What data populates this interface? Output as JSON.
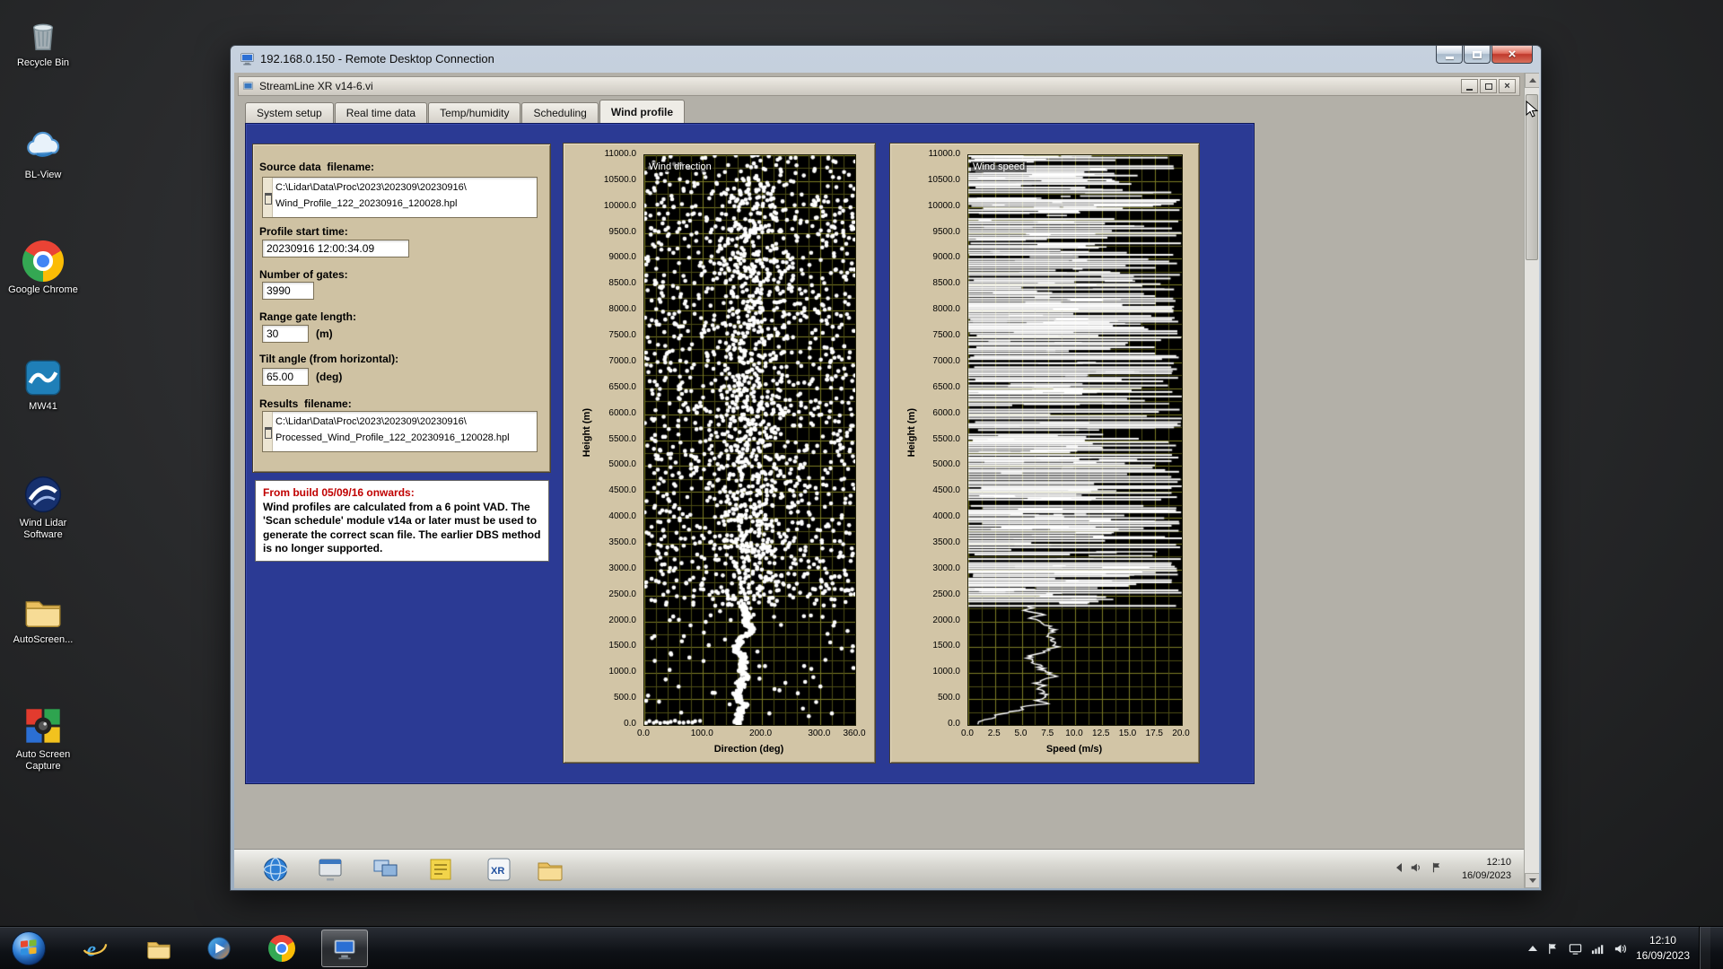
{
  "desktop": {
    "icons": [
      {
        "name": "recycle-bin",
        "label": "Recycle Bin"
      },
      {
        "name": "bl-view",
        "label": "BL-View"
      },
      {
        "name": "google-chrome",
        "label": "Google Chrome"
      },
      {
        "name": "mw41",
        "label": "MW41"
      },
      {
        "name": "wind-lidar-software",
        "label": "Wind Lidar Software"
      },
      {
        "name": "autoscreen",
        "label": "AutoScreen..."
      },
      {
        "name": "auto-screen-capture",
        "label": "Auto Screen Capture"
      }
    ]
  },
  "rdp": {
    "title": "192.168.0.150 - Remote Desktop Connection"
  },
  "app": {
    "title": "StreamLine XR v14-6.vi",
    "tabs": [
      {
        "label": "System setup",
        "active": false
      },
      {
        "label": "Real time data",
        "active": false
      },
      {
        "label": "Temp/humidity",
        "active": false
      },
      {
        "label": "Scheduling",
        "active": false
      },
      {
        "label": "Wind profile",
        "active": true
      }
    ],
    "fields": {
      "source_label": "Source data  filename:",
      "source_line1": "C:\\Lidar\\Data\\Proc\\2023\\202309\\20230916\\",
      "source_line2": "Wind_Profile_122_20230916_120028.hpl",
      "start_label": "Profile start time:",
      "start_value": "20230916 12:00:34.09",
      "gates_label": "Number of gates:",
      "gates_value": "3990",
      "range_label": "Range gate length:",
      "range_value": "30",
      "range_unit": "(m)",
      "tilt_label": "Tilt angle (from horizontal):",
      "tilt_value": "65.00",
      "tilt_unit": "(deg)",
      "results_label": "Results  filename:",
      "results_line1": "C:\\Lidar\\Data\\Proc\\2023\\202309\\20230916\\",
      "results_line2": "Processed_Wind_Profile_122_20230916_120028.hpl"
    },
    "notice": {
      "heading": "From build 05/09/16 onwards:",
      "body": "Wind profiles are calculated from a 6 point VAD. The 'Scan schedule' module v14a or later must be used to generate the correct scan file. The earlier DBS method is no longer supported."
    }
  },
  "chart_data": [
    {
      "type": "scatter",
      "title": "Wind direction",
      "xlabel": "Direction (deg)",
      "ylabel": "Height (m)",
      "xlim": [
        0,
        360
      ],
      "ylim": [
        0,
        11000
      ],
      "xticks": [
        0,
        100,
        200,
        300,
        360
      ],
      "yticks": [
        0,
        500,
        1000,
        1500,
        2000,
        2500,
        3000,
        3500,
        4000,
        4500,
        5000,
        5500,
        6000,
        6500,
        7000,
        7500,
        8000,
        8500,
        9000,
        9500,
        10000,
        10500,
        11000
      ],
      "grid": true,
      "plot_bg": "#000000",
      "grid_minor": "#4c4c16",
      "grid_major": "#7d7d26",
      "point_color": "#ffffff",
      "pattern": {
        "seed": 20230916,
        "noise_points": 1500,
        "cluster_points": 650,
        "cluster_center_deg": 185,
        "cluster_sd_deg": 80,
        "noise_above_m": 2300,
        "outlier_points": 70,
        "profile_top_m": 2300,
        "profile_start_deg": 172
      }
    },
    {
      "type": "line",
      "title": "Wind speed",
      "xlabel": "Speed (m/s)",
      "ylabel": "Height (m)",
      "xlim": [
        0,
        20
      ],
      "ylim": [
        0,
        11000
      ],
      "xticks": [
        0,
        2.5,
        5,
        7.5,
        10,
        12.5,
        15,
        17.5,
        20
      ],
      "yticks": [
        0,
        500,
        1000,
        1500,
        2000,
        2500,
        3000,
        3500,
        4000,
        4500,
        5000,
        5500,
        6000,
        6500,
        7000,
        7500,
        8000,
        8500,
        9000,
        9500,
        10000,
        10500,
        11000
      ],
      "grid": true,
      "plot_bg": "#000000",
      "grid_minor": "#4c4c16",
      "grid_major": "#7d7d26",
      "line_color": "#ffffff",
      "pattern": {
        "seed": 77,
        "row_step_m": 40,
        "skip_prob": 0.11,
        "full_width_prob": 0.33,
        "noisy_above_m": 2280,
        "profile_speed_start": 5.2
      }
    }
  ],
  "session_taskbar": {
    "time": "12:10",
    "date": "16/09/2023"
  },
  "taskbar": {
    "time": "12:10",
    "date": "16/09/2023"
  }
}
